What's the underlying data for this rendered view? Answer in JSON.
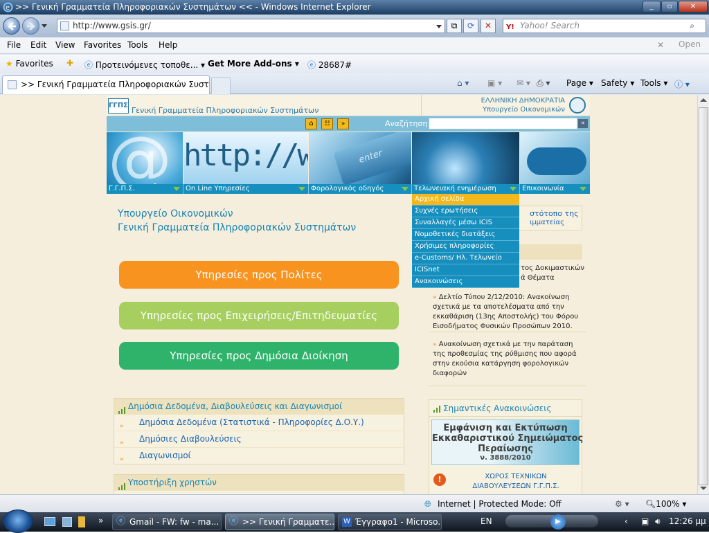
{
  "window": {
    "title": ">> Γενική Γραμματεία Πληροφοριακών Συστημάτων << - Windows Internet Explorer"
  },
  "address": {
    "url": "http://www.gsis.gr/",
    "search_placeholder": "Yahoo! Search",
    "search_brand": "Y!"
  },
  "menu": [
    "File",
    "Edit",
    "View",
    "Favorites",
    "Tools",
    "Help"
  ],
  "toolbar_right_open": "Open",
  "favbar": {
    "favorites": "Favorites",
    "suggested": "Προτεινόμενες τοποθε...",
    "addons": "Get More Add-ons",
    "item": "28687#"
  },
  "tab": {
    "label": ">> Γενική Γραμματεία Πληροφοριακών Συστημ..."
  },
  "commandbar": {
    "page": "Page",
    "safety": "Safety",
    "tools": "Tools"
  },
  "site": {
    "org_name": "Γενική Γραμματεία Πληροφοριακών Συστημάτων",
    "header_right_1": "ΕΛΛΗΝΙΚΗ ΔΗΜΟΚΡΑΤΙΑ",
    "header_right_2": "Υπουργείο Οικονομικών",
    "search_label": "Αναζήτηση",
    "banner_text_1": "http://www",
    "banner_text_2": "enter",
    "nav": [
      "Γ.Γ.Π.Σ.",
      "On Line Υπηρεσίες",
      "Φορολογικός οδηγός",
      "Τελωνειακή ενημέρωση",
      "Επικοινωνία"
    ],
    "dropdown": [
      "Αρχική σελίδα",
      "Συχνές ερωτήσεις",
      "Συναλλαγές μέσω ICIS",
      "Νομοθετικές διατάξεις",
      "Χρήσιμες πληροφορίες",
      "e-Customs/ Ηλ. Τελωνείο",
      "ICISnet",
      "Ανακοινώσεις"
    ],
    "ministry_line1": "Υπουργείο Οικονομικών",
    "ministry_line2": "Γενική Γραμματεία Πληροφοριακών Συστημάτων",
    "btn_citizens": "Υπηρεσίες προς Πολίτες",
    "btn_business": "Υπηρεσίες προς Επιχειρήσεις/Επιτηδευματίες",
    "btn_public": "Υπηρεσίες προς Δημόσια Διοίκηση",
    "section1": {
      "title": "Δημόσια Δεδομένα, Διαβουλεύσεις και Διαγωνισμοί",
      "items": [
        "Δημόσια Δεδομένα (Στατιστικά - Πληροφορίες Δ.Ο.Υ.)",
        "Δημόσιες Διαβουλεύσεις",
        "Διαγωνισμοί"
      ]
    },
    "section2": {
      "title": "Υποστήριξη χρηστών"
    },
    "right": {
      "partial1": "στότοπο της",
      "partial2": "ιμματείας",
      "partial3": "τος Δοκιμαστικών",
      "partial4": "ά Θέματα",
      "news1": "Δελτίο Τύπου 2/12/2010: Ανακοίνωση σχετικά με τα αποτελέσματα από την εκκαθάριση (13ης Αποστολής) του Φόρου Εισοδήματος Φυσικών Προσώπων 2010.",
      "news2": "Ανακοίνωση σχετικά με την παράταση της προθεσμίας της ρύθμισης που αφορά στην εκούσια κατάργηση φορολογικών διαφορών",
      "important_title": "Σημαντικές Ανακοινώσεις",
      "promo_line1": "Εμφάνιση και Εκτύπωση",
      "promo_line2": "Εκκαθαριστικού Σημειώματος",
      "promo_line3": "Περαίωσης",
      "promo_version": "ν. 3888/2010",
      "tech_line1": "ΧΩΡΟΣ ΤΕΧΝΙΚΩΝ",
      "tech_line2": "ΔΙΑΒΟΥΛΕΥΣΕΩΝ Γ.Γ.Π.Σ."
    }
  },
  "status": {
    "zone": "Internet | Protected Mode: Off",
    "zoom": "100%"
  },
  "taskbar": {
    "items": [
      "Gmail - FW: fw - ma...",
      ">> Γενική Γραμματε...",
      "Έγγραφο1 - Microso..."
    ],
    "lang": "EN",
    "clock": "12:26 μμ"
  },
  "colors": {
    "site_blue": "#168fbe",
    "orange_btn": "#f7931e",
    "lightgreen_btn": "#a6cf5f",
    "green_btn": "#2fb36b",
    "page_bg": "#f5eedc"
  }
}
